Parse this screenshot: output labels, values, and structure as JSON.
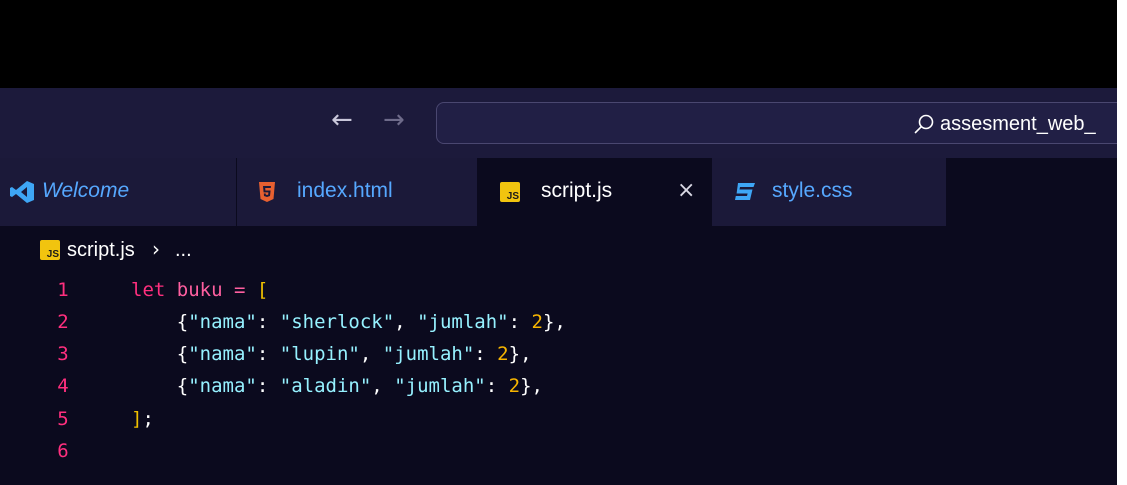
{
  "titlebar": {
    "back_arrow": "←",
    "forward_arrow": "→",
    "search_text": "assesment_web_",
    "search_icon": "search-icon"
  },
  "tabs": [
    {
      "label": "Welcome",
      "icon": "vscode-logo-icon",
      "active": false
    },
    {
      "label": "index.html",
      "icon": "html5-icon",
      "active": false
    },
    {
      "label": "script.js",
      "icon": "js-file-icon",
      "active": true,
      "badge": "JS",
      "close": "×"
    },
    {
      "label": "style.css",
      "icon": "css3-icon",
      "active": false
    }
  ],
  "breadcrumb": {
    "badge": "JS",
    "file": "script.js",
    "separator": "›",
    "more": "..."
  },
  "editor": {
    "line_numbers": [
      "1",
      "2",
      "3",
      "4",
      "5",
      "6"
    ],
    "code": {
      "l1": {
        "kw": "let",
        "var": "buku",
        "op": "=",
        "br": "["
      },
      "l2": {
        "ob": "{",
        "k1": "\"nama\"",
        "c1": ":",
        "v1": "\"sherlock\"",
        "cm": ",",
        "k2": "\"jumlah\"",
        "c2": ":",
        "n": "2",
        "cb": "},"
      },
      "l3": {
        "ob": "{",
        "k1": "\"nama\"",
        "c1": ":",
        "v1": "\"lupin\"",
        "cm": ",",
        "k2": "\"jumlah\"",
        "c2": ":",
        "n": "2",
        "cb": "},"
      },
      "l4": {
        "ob": "{",
        "k1": "\"nama\"",
        "c1": ":",
        "v1": "\"aladin\"",
        "cm": ",",
        "k2": "\"jumlah\"",
        "c2": ":",
        "n": "2",
        "cb": "},"
      },
      "l5": {
        "br": "]",
        "semi": ";"
      }
    }
  },
  "colors": {
    "titlebar_bg": "#1c1a3b",
    "editor_bg": "#0b0a1e",
    "inactive_tab_bg": "#1b1939",
    "keyword": "#ff2f7e",
    "string": "#96f1ff",
    "number": "#f7b500",
    "tab_label": "#56a8ff",
    "js_badge": "#f1c40f"
  }
}
